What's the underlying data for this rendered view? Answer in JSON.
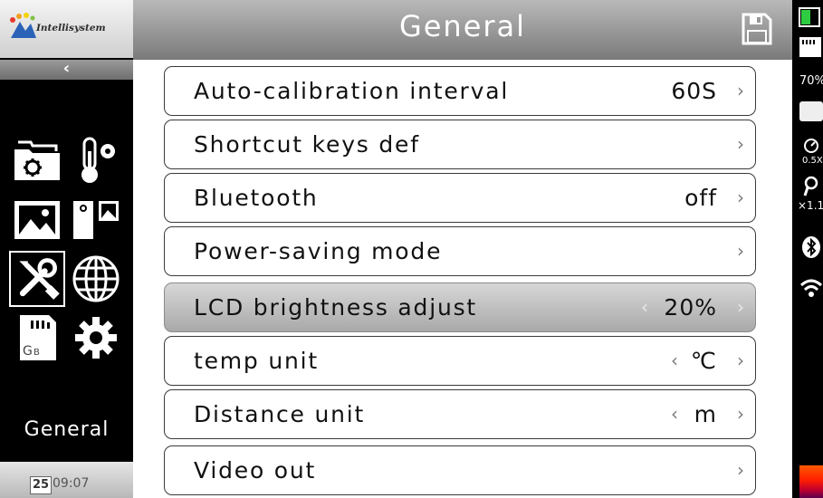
{
  "brand": {
    "logo_text": "Intellisystem"
  },
  "sidebar": {
    "back_label": "‹",
    "title": "General",
    "icons": [
      {
        "name": "folder-settings-icon",
        "selected": false
      },
      {
        "name": "thermometer-settings-icon",
        "selected": false
      },
      {
        "name": "image-icon",
        "selected": false
      },
      {
        "name": "image-compare-icon",
        "selected": false
      },
      {
        "name": "tools-icon",
        "selected": true
      },
      {
        "name": "globe-icon",
        "selected": false
      },
      {
        "name": "sd-card-icon",
        "selected": false,
        "label": "GB"
      },
      {
        "name": "gear-icon",
        "selected": false
      }
    ],
    "date_day": "25",
    "time": "09:07"
  },
  "header": {
    "title": "General",
    "save_icon": "save-icon"
  },
  "settings": [
    {
      "label": "Auto-calibration interval",
      "value": "60S",
      "left_arrow": false,
      "highlighted": false
    },
    {
      "label": "Shortcut keys def",
      "value": "",
      "left_arrow": false,
      "highlighted": false
    },
    {
      "label": "Bluetooth",
      "value": "off",
      "left_arrow": false,
      "highlighted": false
    },
    {
      "label": "Power-saving mode",
      "value": "",
      "left_arrow": false,
      "highlighted": false
    },
    {
      "label": "LCD brightness adjust",
      "value": "20%",
      "left_arrow": true,
      "highlighted": true
    },
    {
      "label": "temp unit",
      "value": "℃",
      "left_arrow": true,
      "highlighted": false
    },
    {
      "label": "Distance unit",
      "value": "m",
      "left_arrow": true,
      "highlighted": false
    },
    {
      "label": "Video out",
      "value": "",
      "left_arrow": false,
      "highlighted": false
    }
  ],
  "status": {
    "battery_percent": "70%",
    "aperture_zoom": "0.5X",
    "zoom": "×1.1",
    "bluetooth_icon": "bluetooth-icon",
    "wifi_icon": "wifi-icon"
  },
  "colors": {
    "header_gradient_top": "#b9b9b9",
    "header_gradient_bottom": "#7a7a7a",
    "highlight_row": "#bdbdbd",
    "sidebar_bg": "#000000"
  }
}
